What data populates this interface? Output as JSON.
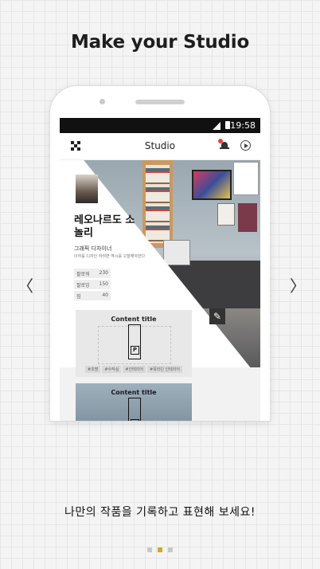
{
  "headline": "Make your Studio",
  "status_bar": {
    "time": "19:58"
  },
  "app_bar": {
    "title": "Studio"
  },
  "profile": {
    "name": "레오나르도 소놀리",
    "role": "그래픽 디자이너",
    "description": "이하를 디자인 하려면 역시를 고찰해야한다",
    "stats": [
      {
        "label": "팔로워",
        "value": "230"
      },
      {
        "label": "팔로잉",
        "value": "150"
      },
      {
        "label": "짐",
        "value": "40"
      }
    ]
  },
  "cards": [
    {
      "title": "Content title",
      "tags": [
        "#조명",
        "#수작실",
        "#인테리어",
        "#폭라딘 인테리어"
      ]
    },
    {
      "title": "Content title"
    }
  ],
  "tagline": "나만의 작품을 기록하고 표현해 보세요!",
  "navigation": {
    "prev": "〈",
    "next": "〉"
  },
  "pager": {
    "total": 3,
    "active_index": 1
  },
  "colors": {
    "accent": "#d9a520",
    "notification": "#e8453c"
  }
}
